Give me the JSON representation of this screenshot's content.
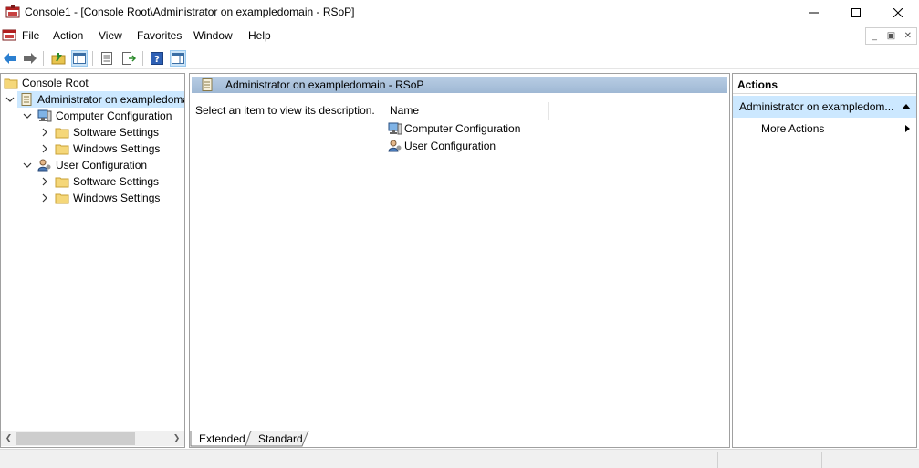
{
  "window": {
    "title": "Console1 - [Console Root\\Administrator on exampledomain - RSoP]"
  },
  "menu": {
    "items": [
      "File",
      "Action",
      "View",
      "Favorites",
      "Window",
      "Help"
    ]
  },
  "toolbar": {
    "icons": [
      "back-icon",
      "forward-icon",
      "up-one-level-icon",
      "show-hide-console-tree-icon",
      "properties-icon",
      "export-list-icon",
      "help-icon",
      "show-hide-action-pane-icon"
    ]
  },
  "tree": {
    "root": "Console Root",
    "rsop": "Administrator on exampledomain - RSoP",
    "computer_config": "Computer Configuration",
    "user_config": "User Configuration",
    "software_settings": "Software Settings",
    "windows_settings": "Windows Settings"
  },
  "center": {
    "header": "Administrator on exampledomain - RSoP",
    "description": "Select an item to view its description.",
    "column_name": "Name",
    "rows": [
      "Computer Configuration",
      "User Configuration"
    ],
    "tabs": [
      "Extended",
      "Standard"
    ]
  },
  "actions": {
    "title": "Actions",
    "group": "Administrator on exampledom...",
    "item": "More Actions"
  },
  "colors": {
    "selection": "#cce8ff",
    "header_gradient": "#b8cde4",
    "border": "#a0a0a0"
  }
}
